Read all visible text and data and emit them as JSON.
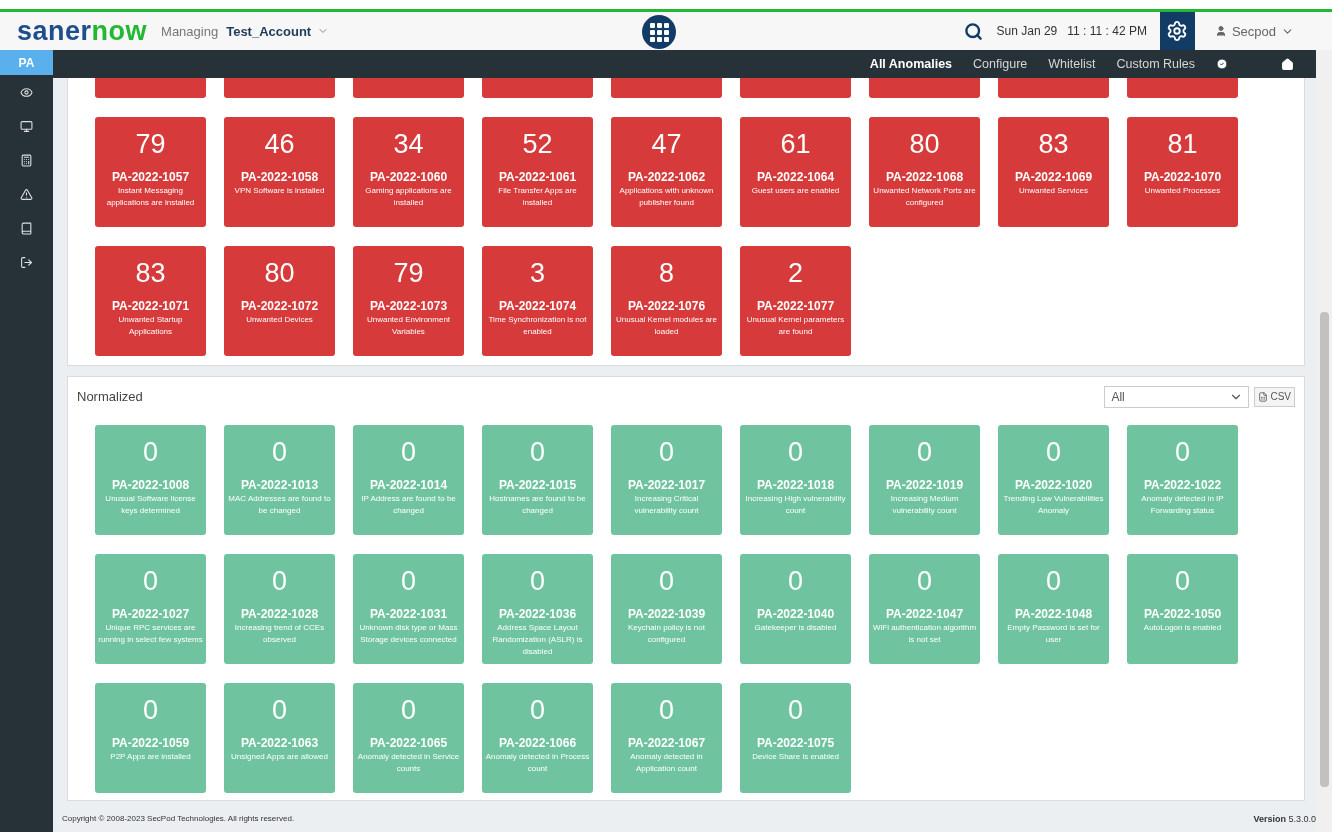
{
  "header": {
    "logo_first": "saner",
    "logo_second": "now",
    "managing_label": "Managing",
    "account": "Test_Account",
    "date": "Sun Jan 29",
    "time": "11 : 11 : 42 PM",
    "user": "Secpod"
  },
  "sidebar": {
    "module": "PA"
  },
  "nav": [
    {
      "label": "All Anomalies",
      "selected": true
    },
    {
      "label": "Configure",
      "selected": false
    },
    {
      "label": "Whitelist",
      "selected": false
    },
    {
      "label": "Custom Rules",
      "selected": false
    }
  ],
  "sections": [
    {
      "color": "#d63a3a",
      "partial_tiles": [
        {
          "cut": true
        },
        {
          "cut": true
        },
        {
          "cut": true
        },
        {
          "cut": true
        },
        {
          "cut": true
        },
        {
          "cut": true
        },
        {
          "cut": true
        },
        {
          "cut": true
        },
        {
          "cut": true
        }
      ],
      "tiles": [
        {
          "count": "79",
          "id": "PA-2022-1057",
          "desc": "Instant Messaging applications are installed"
        },
        {
          "count": "46",
          "id": "PA-2022-1058",
          "desc": "VPN Software is installed"
        },
        {
          "count": "34",
          "id": "PA-2022-1060",
          "desc": "Gaming applications are installed"
        },
        {
          "count": "52",
          "id": "PA-2022-1061",
          "desc": "File Transfer Apps are installed"
        },
        {
          "count": "47",
          "id": "PA-2022-1062",
          "desc": "Applications with unknown publisher found"
        },
        {
          "count": "61",
          "id": "PA-2022-1064",
          "desc": "Guest users are enabled"
        },
        {
          "count": "80",
          "id": "PA-2022-1068",
          "desc": "Unwanted Network Ports are configured"
        },
        {
          "count": "83",
          "id": "PA-2022-1069",
          "desc": "Unwanted Services"
        },
        {
          "count": "81",
          "id": "PA-2022-1070",
          "desc": "Unwanted Processes"
        },
        {
          "count": "83",
          "id": "PA-2022-1071",
          "desc": "Unwanted Startup Applications"
        },
        {
          "count": "80",
          "id": "PA-2022-1072",
          "desc": "Unwanted Devices"
        },
        {
          "count": "79",
          "id": "PA-2022-1073",
          "desc": "Unwanted Environment Variables"
        },
        {
          "count": "3",
          "id": "PA-2022-1074",
          "desc": "Time Synchronization is not enabled"
        },
        {
          "count": "8",
          "id": "PA-2022-1076",
          "desc": "Unusual Kernel modules are loaded"
        },
        {
          "count": "2",
          "id": "PA-2022-1077",
          "desc": "Unusual Kernel parameters are found"
        }
      ]
    },
    {
      "color": "#6fc49f",
      "title": "Normalized",
      "filter": "All",
      "export": "CSV",
      "tiles": [
        {
          "count": "0",
          "id": "PA-2022-1008",
          "desc": "Unusual Software license keys determined"
        },
        {
          "count": "0",
          "id": "PA-2022-1013",
          "desc": "MAC Addresses are found to be changed"
        },
        {
          "count": "0",
          "id": "PA-2022-1014",
          "desc": "IP Address are found to be changed"
        },
        {
          "count": "0",
          "id": "PA-2022-1015",
          "desc": "Hostnames are found to be changed"
        },
        {
          "count": "0",
          "id": "PA-2022-1017",
          "desc": "Increasing Critical vulnerability count"
        },
        {
          "count": "0",
          "id": "PA-2022-1018",
          "desc": "Increasing High vulnerability count"
        },
        {
          "count": "0",
          "id": "PA-2022-1019",
          "desc": "Increasing Medium vulnerability count"
        },
        {
          "count": "0",
          "id": "PA-2022-1020",
          "desc": "Trending Low Vulnerabilities Anomaly"
        },
        {
          "count": "0",
          "id": "PA-2022-1022",
          "desc": "Anomaly detected in IP Forwarding status"
        },
        {
          "count": "0",
          "id": "PA-2022-1027",
          "desc": "Unique RPC services are running in select few systems"
        },
        {
          "count": "0",
          "id": "PA-2022-1028",
          "desc": "Increasing trend of CCEs observed"
        },
        {
          "count": "0",
          "id": "PA-2022-1031",
          "desc": "Unknown disk type or Mass Storage devices connected"
        },
        {
          "count": "0",
          "id": "PA-2022-1036",
          "desc": "Address Space Layout Randomization (ASLR) is disabled"
        },
        {
          "count": "0",
          "id": "PA-2022-1039",
          "desc": "Keychain policy is not configured"
        },
        {
          "count": "0",
          "id": "PA-2022-1040",
          "desc": "Gatekeeper is disabled"
        },
        {
          "count": "0",
          "id": "PA-2022-1047",
          "desc": "WiFi authentication algorithm is not set"
        },
        {
          "count": "0",
          "id": "PA-2022-1048",
          "desc": "Empty Password is set for user"
        },
        {
          "count": "0",
          "id": "PA-2022-1050",
          "desc": "AutoLogon is enabled"
        },
        {
          "count": "0",
          "id": "PA-2022-1059",
          "desc": "P2P Apps are installed"
        },
        {
          "count": "0",
          "id": "PA-2022-1063",
          "desc": "Unsigned Apps are allowed"
        },
        {
          "count": "0",
          "id": "PA-2022-1065",
          "desc": "Anomaly detected in Service counts"
        },
        {
          "count": "0",
          "id": "PA-2022-1066",
          "desc": "Anomaly detected in Process count"
        },
        {
          "count": "0",
          "id": "PA-2022-1067",
          "desc": "Anomaly detected in Application count"
        },
        {
          "count": "0",
          "id": "PA-2022-1075",
          "desc": "Device Share is enabled"
        }
      ]
    }
  ],
  "footer": {
    "copyright": "Copyright © 2008-2023 SecPod Technologies. All rights reserved.",
    "version_label": "Version",
    "version": "5.3.0.0"
  }
}
